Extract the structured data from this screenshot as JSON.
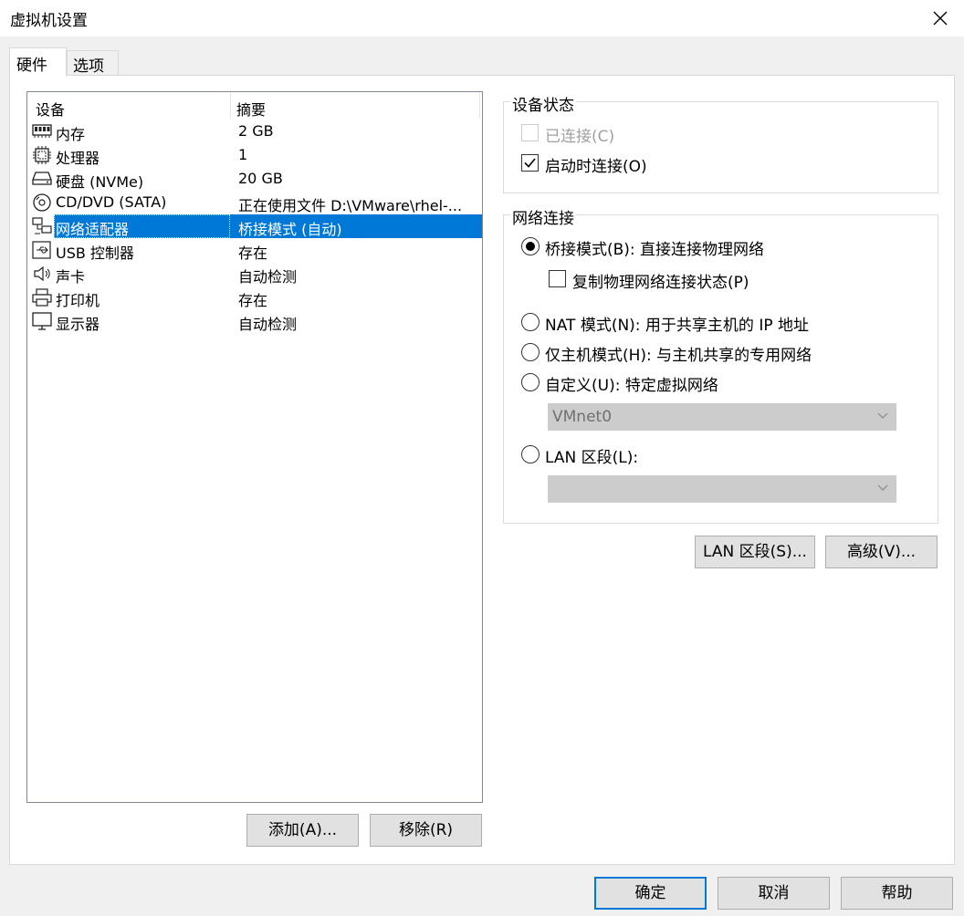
{
  "window": {
    "title": "虚拟机设置"
  },
  "tabs": [
    {
      "label": "硬件"
    },
    {
      "label": "选项"
    }
  ],
  "device_table": {
    "columns": [
      "设备",
      "摘要"
    ],
    "rows": [
      {
        "name": "内存",
        "summary": "2 GB",
        "icon": "memory-icon"
      },
      {
        "name": "处理器",
        "summary": "1",
        "icon": "processor-icon"
      },
      {
        "name": "硬盘 (NVMe)",
        "summary": "20 GB",
        "icon": "hard-disk-icon"
      },
      {
        "name": "CD/DVD (SATA)",
        "summary": "正在使用文件 D:\\VMware\\rhel-...",
        "icon": "cd-dvd-icon"
      },
      {
        "name": "网络适配器",
        "summary": "桥接模式 (自动)",
        "icon": "network-adapter-icon",
        "selected": true
      },
      {
        "name": "USB 控制器",
        "summary": "存在",
        "icon": "usb-icon"
      },
      {
        "name": "声卡",
        "summary": "自动检测",
        "icon": "sound-card-icon"
      },
      {
        "name": "打印机",
        "summary": "存在",
        "icon": "printer-icon"
      },
      {
        "name": "显示器",
        "summary": "自动检测",
        "icon": "display-icon"
      }
    ]
  },
  "left_buttons": {
    "add": "添加(A)...",
    "remove": "移除(R)"
  },
  "device_status": {
    "legend": "设备状态",
    "connected": {
      "label": "已连接(C)",
      "checked": false,
      "disabled": true
    },
    "connect_at_power_on": {
      "label": "启动时连接(O)",
      "checked": true
    }
  },
  "network_connection": {
    "legend": "网络连接",
    "bridged": {
      "label": "桥接模式(B): 直接连接物理网络",
      "selected": true
    },
    "replicate": {
      "label": "复制物理网络连接状态(P)",
      "checked": false
    },
    "nat": {
      "label": "NAT 模式(N): 用于共享主机的 IP 地址"
    },
    "host_only": {
      "label": "仅主机模式(H): 与主机共享的专用网络"
    },
    "custom": {
      "label": "自定义(U): 特定虚拟网络",
      "value": "VMnet0"
    },
    "lan_segment": {
      "label": "LAN 区段(L):",
      "value": ""
    }
  },
  "right_buttons": {
    "lan_segments": "LAN 区段(S)...",
    "advanced": "高级(V)..."
  },
  "footer": {
    "ok": "确定",
    "cancel": "取消",
    "help": "帮助"
  },
  "colors": {
    "selection": "#0078d7",
    "dialog_bg": "#f0f0f0",
    "button_bg": "#e1e1e1"
  }
}
